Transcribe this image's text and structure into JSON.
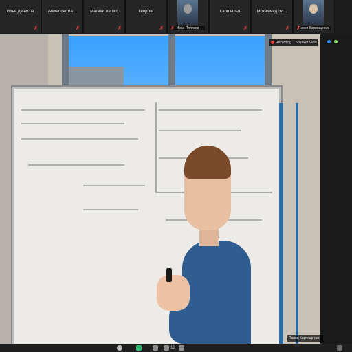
{
  "participants": [
    {
      "name": "Илья Денисов",
      "type": "name"
    },
    {
      "name": "Alexander Ва...",
      "type": "name"
    },
    {
      "name": "Матвей Лёшко",
      "type": "name"
    },
    {
      "name": "Георгий",
      "type": "name"
    },
    {
      "name": "Иван Поляков",
      "type": "video"
    },
    {
      "name": "Larin Илья",
      "type": "name"
    },
    {
      "name": "Мохаммед Эл...",
      "type": "name"
    },
    {
      "name": "Павел Карпощенко",
      "type": "video"
    }
  ],
  "recording": {
    "label": "Recording",
    "view_label": "Speaker View"
  },
  "speaker_name": "Павел Карпощенко",
  "toolbar": {
    "participants_count": "12"
  },
  "colors": {
    "mute": "#e23b3b",
    "accent": "#2d8cff",
    "recording": "#e34040"
  }
}
